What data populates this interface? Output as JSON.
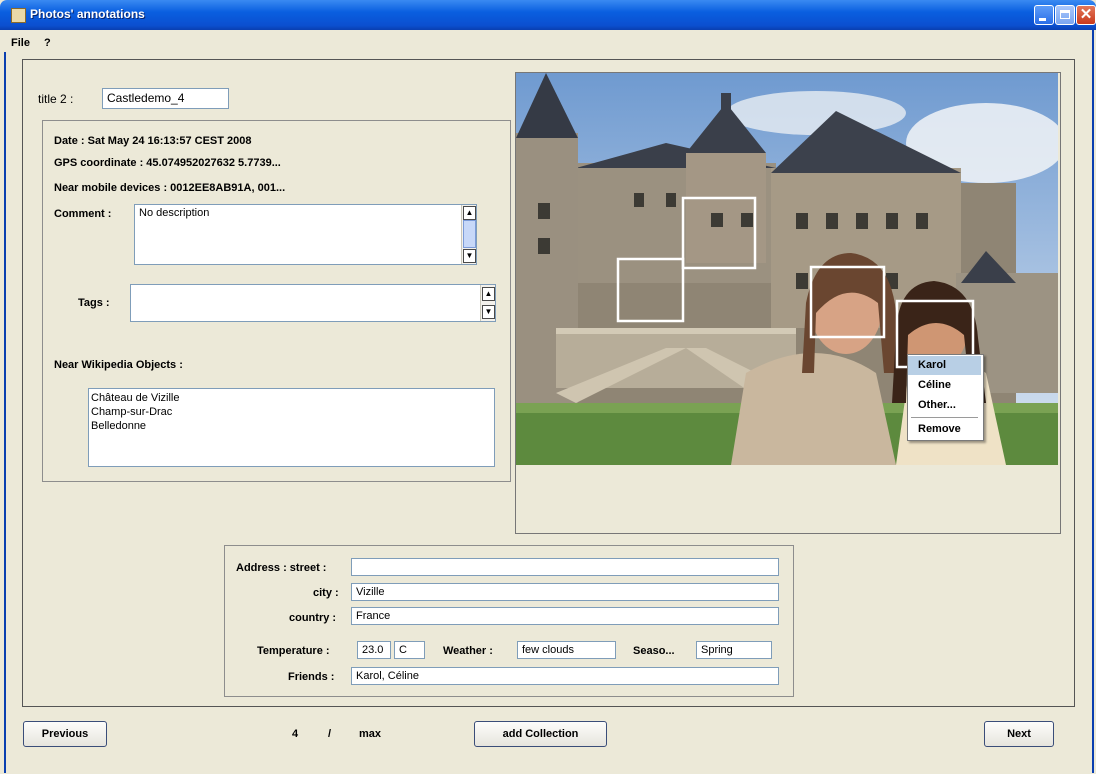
{
  "window": {
    "title": "Photos' annotations"
  },
  "menu": {
    "file": "File",
    "help": "?"
  },
  "photo_info": {
    "title_label": "title 2 :",
    "title_value": "Castledemo_4",
    "date": "Date :  Sat May 24 16:13:57 CEST 2008",
    "gps": "GPS coordinate : 45.074952027632 5.7739...",
    "near_devices": "Near mobile devices : 0012EE8AB91A, 001...",
    "comment_label": "Comment :",
    "comment_value": "No description",
    "tags_label": "Tags :",
    "tags_value": "",
    "wikipedia_label": "Near Wikipedia Objects :",
    "wikipedia_items": [
      "Château de Vizille",
      "Champ-sur-Drac",
      "Belledonne"
    ]
  },
  "context_menu": {
    "items": [
      "Karol",
      "Céline",
      "Other...",
      "Remove"
    ],
    "selected": "Karol"
  },
  "address": {
    "street_label": "Address :  street :",
    "street_value": "",
    "city_label": "city :",
    "city_value": "Vizille",
    "country_label": "country :",
    "country_value": "France",
    "temperature_label": "Temperature :",
    "temperature_value": "23.0",
    "temperature_unit": "C",
    "weather_label": "Weather :",
    "weather_value": "few clouds",
    "season_label": "Seaso...",
    "season_value": "Spring",
    "friends_label": "Friends :",
    "friends_value": "Karol, Céline"
  },
  "navigation": {
    "previous": "Previous",
    "current": "4",
    "separator": "/",
    "max": "max",
    "add_collection": "add Collection",
    "next": "Next"
  },
  "colors": {
    "titlebar": "#0a5fe0",
    "window_bg": "#ece9d8",
    "field_border": "#7f9db9",
    "menu_selection": "#b8cfe5"
  }
}
